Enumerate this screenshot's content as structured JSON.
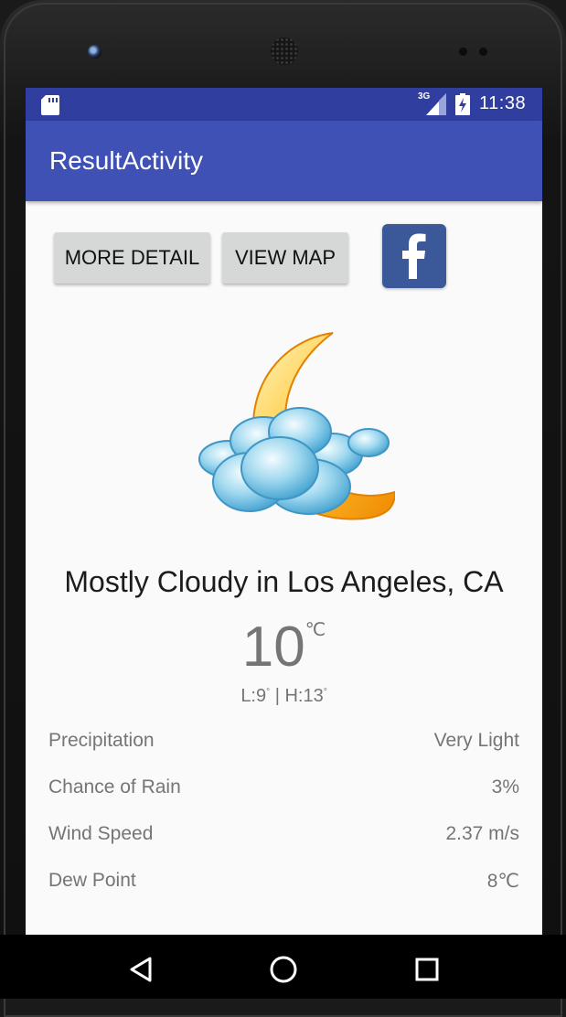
{
  "device": {
    "status_bar": {
      "time": "11:38",
      "network_label": "3G",
      "icons": [
        "sd-card-icon",
        "signal-icon",
        "battery-charging-icon"
      ]
    },
    "nav_icons": [
      "back-icon",
      "home-icon",
      "recents-icon"
    ]
  },
  "app_bar": {
    "title": "ResultActivity"
  },
  "actions": {
    "more_detail": "MORE DETAIL",
    "view_map": "VIEW MAP",
    "share_icon": "facebook-icon"
  },
  "weather": {
    "icon": "partly-cloudy-night-icon",
    "summary": "Mostly Cloudy in Los Angeles, CA",
    "temperature": "10",
    "unit": "℃",
    "low_label": "L:9",
    "separator": "| H:13",
    "degree": "°",
    "details": [
      {
        "label": "Precipitation",
        "value": "Very Light"
      },
      {
        "label": "Chance of Rain",
        "value": "3%"
      },
      {
        "label": "Wind Speed",
        "value": "2.37 m/s"
      },
      {
        "label": "Dew Point",
        "value": "8℃"
      }
    ]
  },
  "colors": {
    "status_bar": "#303f9f",
    "app_bar": "#3f51b5",
    "facebook": "#3b5998",
    "background": "#fafafa"
  }
}
